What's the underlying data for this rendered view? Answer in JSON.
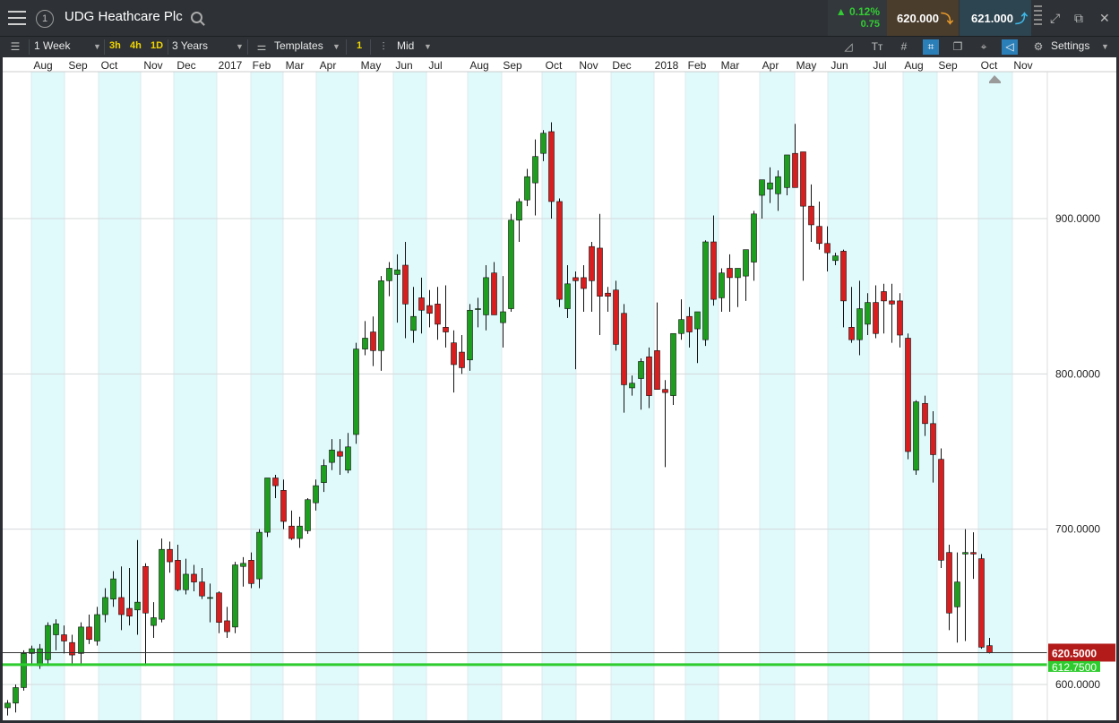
{
  "header": {
    "instrument_number": "1",
    "instrument_name": "UDG Heathcare Plc",
    "change_percent": "0.12%",
    "change_abs": "0.75",
    "sell_price": "620.000",
    "buy_price": "621.000"
  },
  "toolbar": {
    "interval": "1 Week",
    "quick_intervals": [
      "3h",
      "4h",
      "1D"
    ],
    "range": "3 Years",
    "templates_label": "Templates",
    "badge": "1",
    "price_type": "Mid",
    "settings_label": "Settings"
  },
  "colors": {
    "up": "#1e9e1e",
    "down": "#d81e1e",
    "support_line": "#2ecc2e",
    "current_price_bg": "#b31b1b",
    "band": "#e0fafc"
  },
  "chart_data": {
    "type": "candlestick",
    "title": "",
    "xlabel": "",
    "ylabel": "",
    "x_tick_labels": [
      "Aug",
      "Sep",
      "Oct",
      "Nov",
      "Dec",
      "2017",
      "Feb",
      "Mar",
      "Apr",
      "May",
      "Jun",
      "Jul",
      "Aug",
      "Sep",
      "Oct",
      "Nov",
      "Dec",
      "2018",
      "Feb",
      "Mar",
      "Apr",
      "May",
      "Jun",
      "Jul",
      "Aug",
      "Sep",
      "Oct",
      "Nov"
    ],
    "y_ticks": [
      600,
      700,
      800,
      900
    ],
    "y_tick_labels": [
      "600.0000",
      "700.0000",
      "800.0000",
      "900.0000"
    ],
    "ylim": [
      580,
      1000
    ],
    "grid": true,
    "current_price": 620.5,
    "current_price_label": "620.5000",
    "support_level": 612.75,
    "support_label": "612.7500",
    "candles": [
      {
        "o": 585,
        "h": 590,
        "l": 580,
        "c": 588
      },
      {
        "o": 588,
        "h": 600,
        "l": 582,
        "c": 598
      },
      {
        "o": 598,
        "h": 622,
        "l": 596,
        "c": 620
      },
      {
        "o": 620,
        "h": 625,
        "l": 612,
        "c": 623
      },
      {
        "o": 612,
        "h": 626,
        "l": 610,
        "c": 623
      },
      {
        "o": 616,
        "h": 640,
        "l": 612,
        "c": 638
      },
      {
        "o": 632,
        "h": 642,
        "l": 622,
        "c": 639
      },
      {
        "o": 632,
        "h": 638,
        "l": 620,
        "c": 628
      },
      {
        "o": 627,
        "h": 632,
        "l": 612,
        "c": 619
      },
      {
        "o": 620,
        "h": 640,
        "l": 612,
        "c": 637
      },
      {
        "o": 637,
        "h": 645,
        "l": 626,
        "c": 629
      },
      {
        "o": 628,
        "h": 650,
        "l": 625,
        "c": 645
      },
      {
        "o": 645,
        "h": 662,
        "l": 640,
        "c": 656
      },
      {
        "o": 655,
        "h": 673,
        "l": 650,
        "c": 668
      },
      {
        "o": 656,
        "h": 676,
        "l": 635,
        "c": 645
      },
      {
        "o": 649,
        "h": 675,
        "l": 638,
        "c": 644
      },
      {
        "o": 648,
        "h": 693,
        "l": 632,
        "c": 653
      },
      {
        "o": 676,
        "h": 678,
        "l": 612,
        "c": 646
      },
      {
        "o": 638,
        "h": 653,
        "l": 630,
        "c": 643
      },
      {
        "o": 642,
        "h": 694,
        "l": 640,
        "c": 687
      },
      {
        "o": 687,
        "h": 692,
        "l": 672,
        "c": 679
      },
      {
        "o": 680,
        "h": 690,
        "l": 660,
        "c": 661
      },
      {
        "o": 661,
        "h": 681,
        "l": 658,
        "c": 671
      },
      {
        "o": 671,
        "h": 677,
        "l": 660,
        "c": 666
      },
      {
        "o": 666,
        "h": 675,
        "l": 655,
        "c": 657
      },
      {
        "o": 656,
        "h": 665,
        "l": 640,
        "c": 656
      },
      {
        "o": 659,
        "h": 660,
        "l": 633,
        "c": 640
      },
      {
        "o": 641,
        "h": 650,
        "l": 630,
        "c": 634
      },
      {
        "o": 637,
        "h": 679,
        "l": 633,
        "c": 677
      },
      {
        "o": 676,
        "h": 682,
        "l": 663,
        "c": 678
      },
      {
        "o": 680,
        "h": 685,
        "l": 662,
        "c": 665
      },
      {
        "o": 668,
        "h": 700,
        "l": 662,
        "c": 698
      },
      {
        "o": 698,
        "h": 705,
        "l": 695,
        "c": 733
      },
      {
        "o": 733,
        "h": 735,
        "l": 720,
        "c": 728
      },
      {
        "o": 725,
        "h": 732,
        "l": 700,
        "c": 705
      },
      {
        "o": 702,
        "h": 712,
        "l": 693,
        "c": 694
      },
      {
        "o": 694,
        "h": 708,
        "l": 688,
        "c": 702
      },
      {
        "o": 699,
        "h": 720,
        "l": 697,
        "c": 719
      },
      {
        "o": 717,
        "h": 732,
        "l": 712,
        "c": 728
      },
      {
        "o": 730,
        "h": 745,
        "l": 724,
        "c": 741
      },
      {
        "o": 743,
        "h": 758,
        "l": 738,
        "c": 751
      },
      {
        "o": 750,
        "h": 758,
        "l": 735,
        "c": 747
      },
      {
        "o": 738,
        "h": 762,
        "l": 736,
        "c": 753
      },
      {
        "o": 761,
        "h": 820,
        "l": 755,
        "c": 816
      },
      {
        "o": 816,
        "h": 834,
        "l": 812,
        "c": 823
      },
      {
        "o": 827,
        "h": 837,
        "l": 805,
        "c": 815
      },
      {
        "o": 815,
        "h": 863,
        "l": 802,
        "c": 860
      },
      {
        "o": 860,
        "h": 872,
        "l": 850,
        "c": 868
      },
      {
        "o": 864,
        "h": 877,
        "l": 833,
        "c": 867
      },
      {
        "o": 870,
        "h": 885,
        "l": 823,
        "c": 845
      },
      {
        "o": 828,
        "h": 856,
        "l": 820,
        "c": 837
      },
      {
        "o": 849,
        "h": 862,
        "l": 826,
        "c": 841
      },
      {
        "o": 844,
        "h": 854,
        "l": 830,
        "c": 839
      },
      {
        "o": 845,
        "h": 856,
        "l": 822,
        "c": 832
      },
      {
        "o": 830,
        "h": 857,
        "l": 817,
        "c": 827
      },
      {
        "o": 820,
        "h": 828,
        "l": 788,
        "c": 806
      },
      {
        "o": 814,
        "h": 825,
        "l": 800,
        "c": 804
      },
      {
        "o": 809,
        "h": 845,
        "l": 802,
        "c": 841
      },
      {
        "o": 842,
        "h": 849,
        "l": 830,
        "c": 842
      },
      {
        "o": 838,
        "h": 870,
        "l": 828,
        "c": 862
      },
      {
        "o": 865,
        "h": 872,
        "l": 838,
        "c": 838
      },
      {
        "o": 833,
        "h": 863,
        "l": 817,
        "c": 840
      },
      {
        "o": 842,
        "h": 903,
        "l": 840,
        "c": 899
      },
      {
        "o": 899,
        "h": 913,
        "l": 885,
        "c": 911
      },
      {
        "o": 912,
        "h": 932,
        "l": 908,
        "c": 927
      },
      {
        "o": 923,
        "h": 951,
        "l": 902,
        "c": 940
      },
      {
        "o": 942,
        "h": 957,
        "l": 937,
        "c": 955
      },
      {
        "o": 956,
        "h": 962,
        "l": 900,
        "c": 911
      },
      {
        "o": 911,
        "h": 913,
        "l": 843,
        "c": 848
      },
      {
        "o": 842,
        "h": 870,
        "l": 836,
        "c": 858
      },
      {
        "o": 862,
        "h": 866,
        "l": 803,
        "c": 860
      },
      {
        "o": 862,
        "h": 870,
        "l": 840,
        "c": 855
      },
      {
        "o": 882,
        "h": 885,
        "l": 840,
        "c": 860
      },
      {
        "o": 881,
        "h": 903,
        "l": 825,
        "c": 850
      },
      {
        "o": 852,
        "h": 856,
        "l": 840,
        "c": 850
      },
      {
        "o": 854,
        "h": 860,
        "l": 815,
        "c": 819
      },
      {
        "o": 839,
        "h": 845,
        "l": 775,
        "c": 793
      },
      {
        "o": 791,
        "h": 799,
        "l": 786,
        "c": 794
      },
      {
        "o": 797,
        "h": 810,
        "l": 777,
        "c": 808
      },
      {
        "o": 811,
        "h": 817,
        "l": 778,
        "c": 786
      },
      {
        "o": 815,
        "h": 846,
        "l": 800,
        "c": 790
      },
      {
        "o": 790,
        "h": 796,
        "l": 740,
        "c": 788
      },
      {
        "o": 786,
        "h": 823,
        "l": 780,
        "c": 826
      },
      {
        "o": 826,
        "h": 848,
        "l": 822,
        "c": 835
      },
      {
        "o": 837,
        "h": 843,
        "l": 817,
        "c": 827
      },
      {
        "o": 829,
        "h": 838,
        "l": 807,
        "c": 840
      },
      {
        "o": 822,
        "h": 886,
        "l": 818,
        "c": 885
      },
      {
        "o": 885,
        "h": 902,
        "l": 844,
        "c": 848
      },
      {
        "o": 849,
        "h": 868,
        "l": 840,
        "c": 865
      },
      {
        "o": 868,
        "h": 877,
        "l": 840,
        "c": 862
      },
      {
        "o": 862,
        "h": 868,
        "l": 843,
        "c": 868
      },
      {
        "o": 863,
        "h": 880,
        "l": 847,
        "c": 880
      },
      {
        "o": 872,
        "h": 905,
        "l": 860,
        "c": 903
      },
      {
        "o": 915,
        "h": 922,
        "l": 900,
        "c": 925
      },
      {
        "o": 919,
        "h": 933,
        "l": 910,
        "c": 923
      },
      {
        "o": 916,
        "h": 931,
        "l": 905,
        "c": 927
      },
      {
        "o": 920,
        "h": 941,
        "l": 915,
        "c": 941
      },
      {
        "o": 942,
        "h": 961,
        "l": 925,
        "c": 920
      },
      {
        "o": 943,
        "h": 940,
        "l": 860,
        "c": 908
      },
      {
        "o": 908,
        "h": 922,
        "l": 885,
        "c": 896
      },
      {
        "o": 895,
        "h": 911,
        "l": 880,
        "c": 884
      },
      {
        "o": 884,
        "h": 895,
        "l": 866,
        "c": 878
      },
      {
        "o": 873,
        "h": 878,
        "l": 870,
        "c": 876
      },
      {
        "o": 879,
        "h": 880,
        "l": 830,
        "c": 847
      },
      {
        "o": 830,
        "h": 856,
        "l": 820,
        "c": 822
      },
      {
        "o": 822,
        "h": 860,
        "l": 812,
        "c": 842
      },
      {
        "o": 832,
        "h": 852,
        "l": 825,
        "c": 846
      },
      {
        "o": 846,
        "h": 857,
        "l": 823,
        "c": 826
      },
      {
        "o": 853,
        "h": 858,
        "l": 826,
        "c": 847
      },
      {
        "o": 847,
        "h": 858,
        "l": 820,
        "c": 845
      },
      {
        "o": 847,
        "h": 852,
        "l": 817,
        "c": 825
      },
      {
        "o": 823,
        "h": 826,
        "l": 745,
        "c": 750
      },
      {
        "o": 738,
        "h": 783,
        "l": 735,
        "c": 782
      },
      {
        "o": 781,
        "h": 786,
        "l": 760,
        "c": 768
      },
      {
        "o": 768,
        "h": 776,
        "l": 730,
        "c": 748
      },
      {
        "o": 745,
        "h": 752,
        "l": 675,
        "c": 680
      },
      {
        "o": 685,
        "h": 690,
        "l": 635,
        "c": 646
      },
      {
        "o": 650,
        "h": 685,
        "l": 627,
        "c": 666
      },
      {
        "o": 684,
        "h": 700,
        "l": 628,
        "c": 685
      },
      {
        "o": 685,
        "h": 698,
        "l": 668,
        "c": 684
      },
      {
        "o": 681,
        "h": 684,
        "l": 623,
        "c": 624
      },
      {
        "o": 625,
        "h": 630,
        "l": 620,
        "c": 620.5
      }
    ]
  }
}
